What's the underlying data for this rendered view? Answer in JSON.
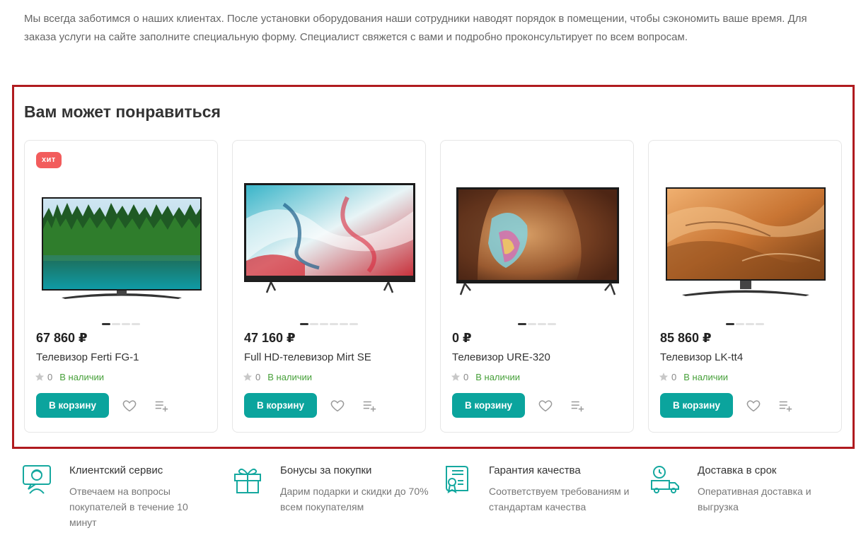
{
  "intro_text": "Мы всегда заботимся о наших клиентах. После установки оборудования наши сотрудники наводят порядок в помещении, чтобы сэкономить ваше время. Для заказа услуги на сайте заполните специальную форму. Специалист свяжется с вами и подробно проконсультирует по всем вопросам.",
  "recommendations": {
    "title": "Вам может понравиться",
    "cart_label": "В корзину",
    "products": [
      {
        "badge": "хит",
        "price": "67 860 ₽",
        "name": "Телевизор Ferti FG-1",
        "rating": "0",
        "stock": "В наличии",
        "screen": "forest-lake-image"
      },
      {
        "badge": "",
        "price": "47 160 ₽",
        "name": "Full HD-телевизор Mirt SE",
        "rating": "0",
        "stock": "В наличии",
        "screen": "abstract-paint-image"
      },
      {
        "badge": "",
        "price": "0 ₽",
        "name": "Телевизор URE-320",
        "rating": "0",
        "stock": "В наличии",
        "screen": "canyon-image"
      },
      {
        "badge": "",
        "price": "85 860 ₽",
        "name": "Телевизор LK-tt4",
        "rating": "0",
        "stock": "В наличии",
        "screen": "desert-dunes-image"
      }
    ]
  },
  "features": [
    {
      "icon": "support-agent-icon",
      "title": "Клиентский сервис",
      "text": "Отвечаем на вопросы покупателей в течение 10 минут"
    },
    {
      "icon": "gift-icon",
      "title": "Бонусы за покупки",
      "text": "Дарим подарки и скидки до 70% всем покупателям"
    },
    {
      "icon": "certificate-icon",
      "title": "Гарантия качества",
      "text": "Соответствуем требованиям и стандартам качества"
    },
    {
      "icon": "delivery-truck-icon",
      "title": "Доставка в срок",
      "text": "Оперативная доставка и выгрузка"
    }
  ],
  "colors": {
    "accent": "#0ba49d",
    "hit_badge": "#f25c5c",
    "in_stock": "#47a03a",
    "highlight_border": "#b01b1f"
  }
}
